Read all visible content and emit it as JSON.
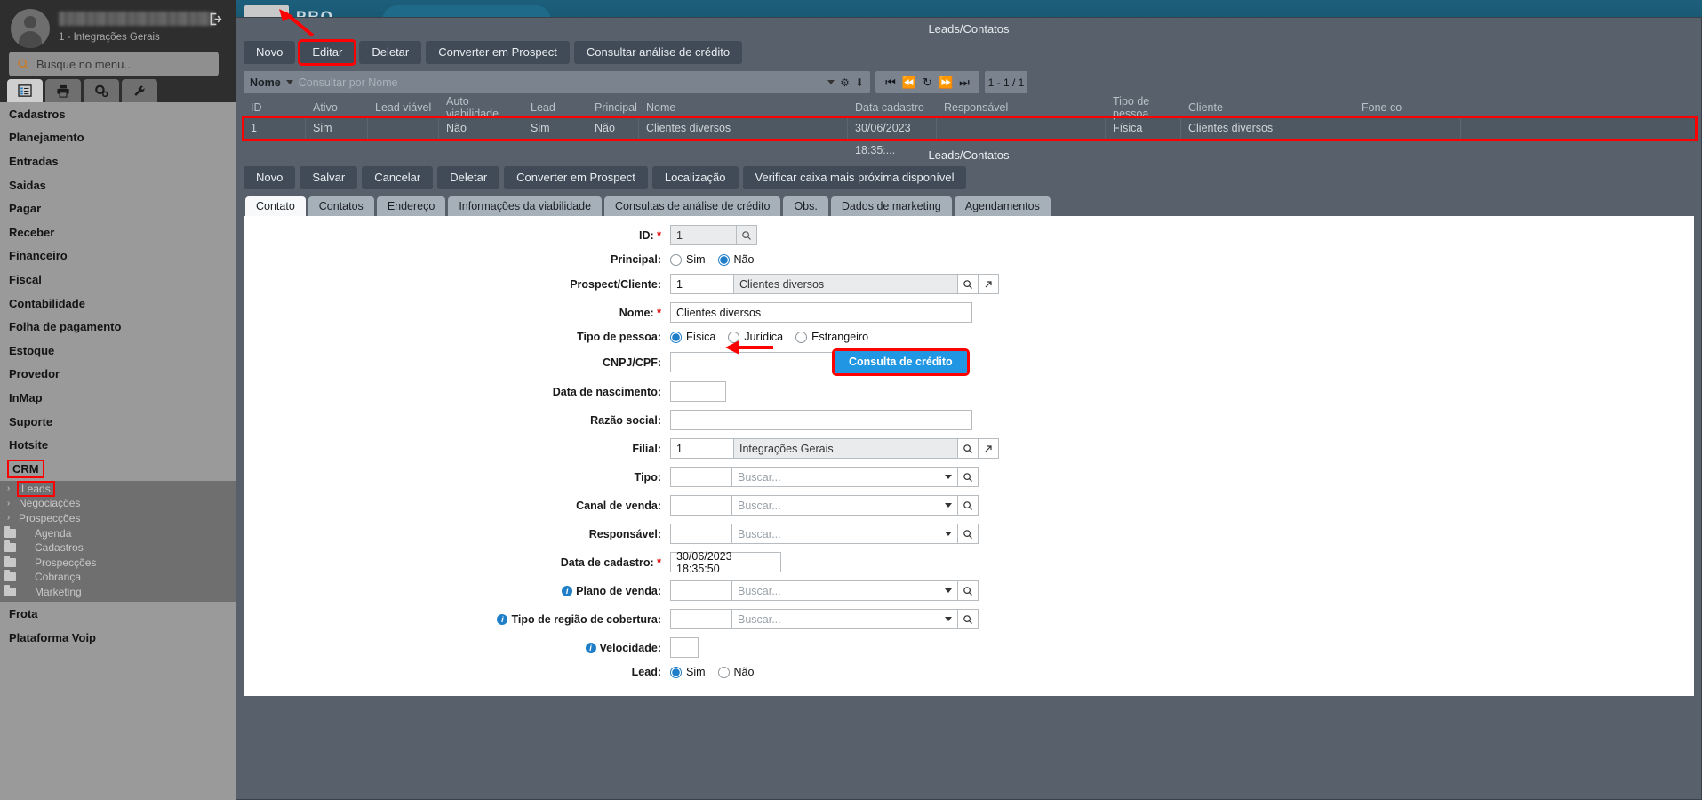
{
  "sidebar": {
    "user_org": "1 - Integrações Gerais",
    "logout_icon": "logout-icon",
    "search_placeholder": "Busque no menu...",
    "tabs": [
      {
        "name": "list-tab",
        "icon": "list-icon"
      },
      {
        "name": "print-tab",
        "icon": "printer-icon"
      },
      {
        "name": "settings-tab",
        "icon": "gears-icon"
      },
      {
        "name": "tools-tab",
        "icon": "wrench-icon"
      }
    ],
    "items": [
      {
        "label": "Cadastros"
      },
      {
        "label": "Planejamento"
      },
      {
        "label": "Entradas"
      },
      {
        "label": "Saidas"
      },
      {
        "label": "Pagar"
      },
      {
        "label": "Receber"
      },
      {
        "label": "Financeiro"
      },
      {
        "label": "Fiscal"
      },
      {
        "label": "Contabilidade"
      },
      {
        "label": "Folha de pagamento"
      },
      {
        "label": "Estoque"
      },
      {
        "label": "Provedor"
      },
      {
        "label": "InMap"
      },
      {
        "label": "Suporte"
      },
      {
        "label": "Hotsite"
      },
      {
        "label": "CRM"
      }
    ],
    "crm_submenu": [
      {
        "label": "Leads",
        "type": "chevron",
        "highlighted": true
      },
      {
        "label": "Negociações",
        "type": "chevron",
        "highlighted": false
      },
      {
        "label": "Prospecções",
        "type": "chevron",
        "highlighted": false
      },
      {
        "label": "Agenda",
        "type": "folder",
        "highlighted": false
      },
      {
        "label": "Cadastros",
        "type": "folder",
        "highlighted": false
      },
      {
        "label": "Prospecções",
        "type": "folder",
        "highlighted": false
      },
      {
        "label": "Cobrança",
        "type": "folder",
        "highlighted": false
      },
      {
        "label": "Marketing",
        "type": "folder",
        "highlighted": false
      }
    ],
    "items_after": [
      {
        "label": "Frota"
      },
      {
        "label": "Plataforma Voip"
      }
    ]
  },
  "appbar": {
    "logo_text": "PRO"
  },
  "list_panel": {
    "title": "Leads/Contatos",
    "buttons": [
      {
        "label": "Novo",
        "highlighted": false
      },
      {
        "label": "Editar",
        "highlighted": true
      },
      {
        "label": "Deletar",
        "highlighted": false
      },
      {
        "label": "Converter em Prospect",
        "highlighted": false
      },
      {
        "label": "Consultar análise de crédito",
        "highlighted": false
      }
    ],
    "search": {
      "field_label": "Nome",
      "placeholder": "Consultar por Nome",
      "icons": [
        "chevron-down-icon",
        "gears-icon",
        "download-icon"
      ]
    },
    "pager": {
      "icons": [
        "first-page-icon",
        "prev-page-icon",
        "refresh-icon",
        "next-page-icon",
        "last-page-icon"
      ],
      "count": "1 - 1 / 1"
    },
    "columns": [
      "ID",
      "Ativo",
      "Lead viável",
      "Auto viabilidade",
      "Lead",
      "Principal",
      "Nome",
      "Data cadastro",
      "Responsável",
      "Tipo de pessoa",
      "Cliente",
      "Fone co"
    ],
    "rows": [
      {
        "id": "1",
        "ativo": "Sim",
        "lead_viavel": "",
        "auto_viabilidade": "Não",
        "lead": "Sim",
        "principal": "Não",
        "nome": "Clientes diversos",
        "data_cadastro": "30/06/2023 18:35:...",
        "responsavel": "",
        "tipo_pessoa": "Física",
        "cliente": "Clientes diversos",
        "fone": ""
      }
    ]
  },
  "form_panel": {
    "title": "Leads/Contatos",
    "buttons": [
      {
        "label": "Novo"
      },
      {
        "label": "Salvar"
      },
      {
        "label": "Cancelar"
      },
      {
        "label": "Deletar"
      },
      {
        "label": "Converter em Prospect"
      },
      {
        "label": "Localização"
      },
      {
        "label": "Verificar caixa mais próxima disponível"
      }
    ],
    "tabs": [
      {
        "label": "Contato",
        "active": true
      },
      {
        "label": "Contatos",
        "active": false
      },
      {
        "label": "Endereço",
        "active": false
      },
      {
        "label": "Informações da viabilidade",
        "active": false
      },
      {
        "label": "Consultas de análise de crédito",
        "active": false
      },
      {
        "label": "Obs.",
        "active": false
      },
      {
        "label": "Dados de marketing",
        "active": false
      },
      {
        "label": "Agendamentos",
        "active": false
      }
    ],
    "fields": {
      "id": {
        "label": "ID:",
        "required": true,
        "value": "1"
      },
      "principal": {
        "label": "Principal:",
        "options": [
          "Sim",
          "Não"
        ],
        "selected": "Não"
      },
      "prospect_cliente": {
        "label": "Prospect/Cliente:",
        "code": "1",
        "name": "Clientes diversos"
      },
      "nome": {
        "label": "Nome:",
        "required": true,
        "value": "Clientes diversos"
      },
      "tipo_pessoa": {
        "label": "Tipo de pessoa:",
        "options": [
          "Física",
          "Jurídica",
          "Estrangeiro"
        ],
        "selected": "Física"
      },
      "cnpj_cpf": {
        "label": "CNPJ/CPF:",
        "value": "",
        "button_label": "Consulta de crédito"
      },
      "data_nascimento": {
        "label": "Data de nascimento:",
        "value": ""
      },
      "razao_social": {
        "label": "Razão social:",
        "value": ""
      },
      "filial": {
        "label": "Filial:",
        "code": "1",
        "name": "Integrações Gerais"
      },
      "tipo": {
        "label": "Tipo:",
        "placeholder": "Buscar..."
      },
      "canal_venda": {
        "label": "Canal de venda:",
        "placeholder": "Buscar..."
      },
      "responsavel": {
        "label": "Responsável:",
        "placeholder": "Buscar..."
      },
      "data_cadastro": {
        "label": "Data de cadastro:",
        "required": true,
        "value": "30/06/2023 18:35:50"
      },
      "plano_venda": {
        "label": "Plano de venda:",
        "placeholder": "Buscar...",
        "info": true
      },
      "tipo_regiao": {
        "label": "Tipo de região de cobertura:",
        "placeholder": "Buscar...",
        "info": true
      },
      "velocidade": {
        "label": "Velocidade:",
        "value": "",
        "info": true
      },
      "lead": {
        "label": "Lead:",
        "options": [
          "Sim",
          "Não"
        ],
        "selected": "Sim",
        "info": false
      }
    }
  },
  "annotations": {
    "highlight_color": "#ff0000",
    "arrows": [
      {
        "name": "arrow-to-editar",
        "target": "Editar"
      },
      {
        "name": "arrow-to-consulta-credito",
        "target": "Consulta de crédito"
      }
    ]
  }
}
